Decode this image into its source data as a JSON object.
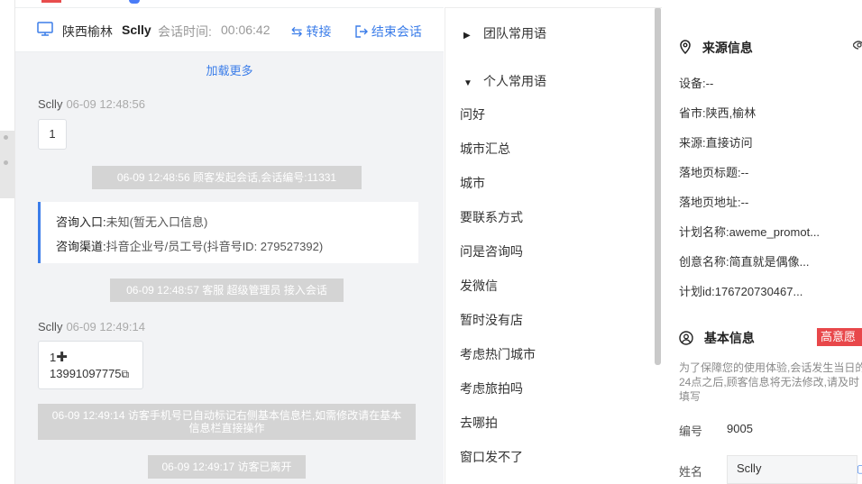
{
  "colors": {
    "accent": "#3b7de9",
    "danger": "#e8474a",
    "system_bg": "#d4d4d4",
    "panel_bg": "#f2f3f5"
  },
  "chat": {
    "header": {
      "monitor_icon": "monitor-icon",
      "location": "陕西榆林",
      "visitor": "Sclly",
      "duration_label": "会话时间:",
      "duration": "00:06:42",
      "transfer_label": "转接",
      "end_label": "结束会话"
    },
    "load_more": "加载更多",
    "messages": [
      {
        "sender": "Sclly",
        "time": "06-09 12:48:56",
        "text": "1"
      },
      {
        "sender": "Sclly",
        "time": "06-09 12:49:14",
        "text_line1": "1",
        "text_line2": "13991097775"
      }
    ],
    "system": [
      "06-09 12:48:56 顾客发起会话,会话编号:11331",
      "06-09 12:48:57 客服 超级管理员 接入会话",
      "06-09 12:49:14 访客手机号已自动标记右侧基本信息栏,如需修改请在基本信息栏直接操作",
      "06-09 12:49:17 访客已离开"
    ],
    "info_card": {
      "entry_label": "咨询入口:",
      "entry_value": "未知(暂无入口信息)",
      "channel_label": "咨询渠道:",
      "channel_value": "抖音企业号/员工号(抖音号ID: 279527392)"
    }
  },
  "phrases": {
    "team_group": "团队常用语",
    "personal_group": "个人常用语",
    "items": [
      "问好",
      "城市汇总",
      "城市",
      "要联系方式",
      "问是咨询吗",
      "发微信",
      "暂时没有店",
      "考虑热门城市",
      "考虑旅拍吗",
      "去哪拍",
      "窗口发不了"
    ]
  },
  "sidebar": {
    "source_title": "来源信息",
    "source_rows": [
      "设备:--",
      "省市:陕西,榆林",
      "来源:直接访问",
      "落地页标题:--",
      "落地页地址:--",
      "计划名称:aweme_promot...",
      "创意名称:简直就是偶像...",
      "计划id:176720730467..."
    ],
    "basic_title": "基本信息",
    "intent_badge": "高意愿",
    "notice": "为了保障您的使用体验,会话发生当日的24点之后,顾客信息将无法修改,请及时填写",
    "id_label": "编号",
    "id_value": "9005",
    "name_label": "姓名",
    "name_value": "Sclly"
  }
}
